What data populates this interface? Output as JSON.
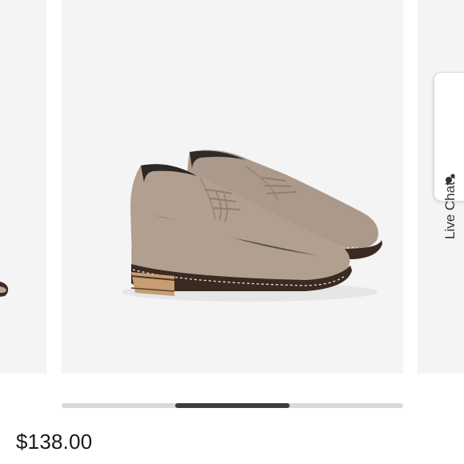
{
  "product": {
    "price": "$138.00"
  },
  "live_chat": {
    "label": "Live Chat",
    "icon": "chat-bubbles-icon"
  },
  "carousel": {
    "image_alt_icon": "suede-chukka-boot-image",
    "scroll_position_fraction": 0.33
  },
  "colors": {
    "slide_background": "#f4f4f4",
    "scroll_thumb": "#3d3d3d",
    "scroll_track": "#d9d9d9",
    "suede": "#b09f8f",
    "sole": "#3a2a22"
  }
}
